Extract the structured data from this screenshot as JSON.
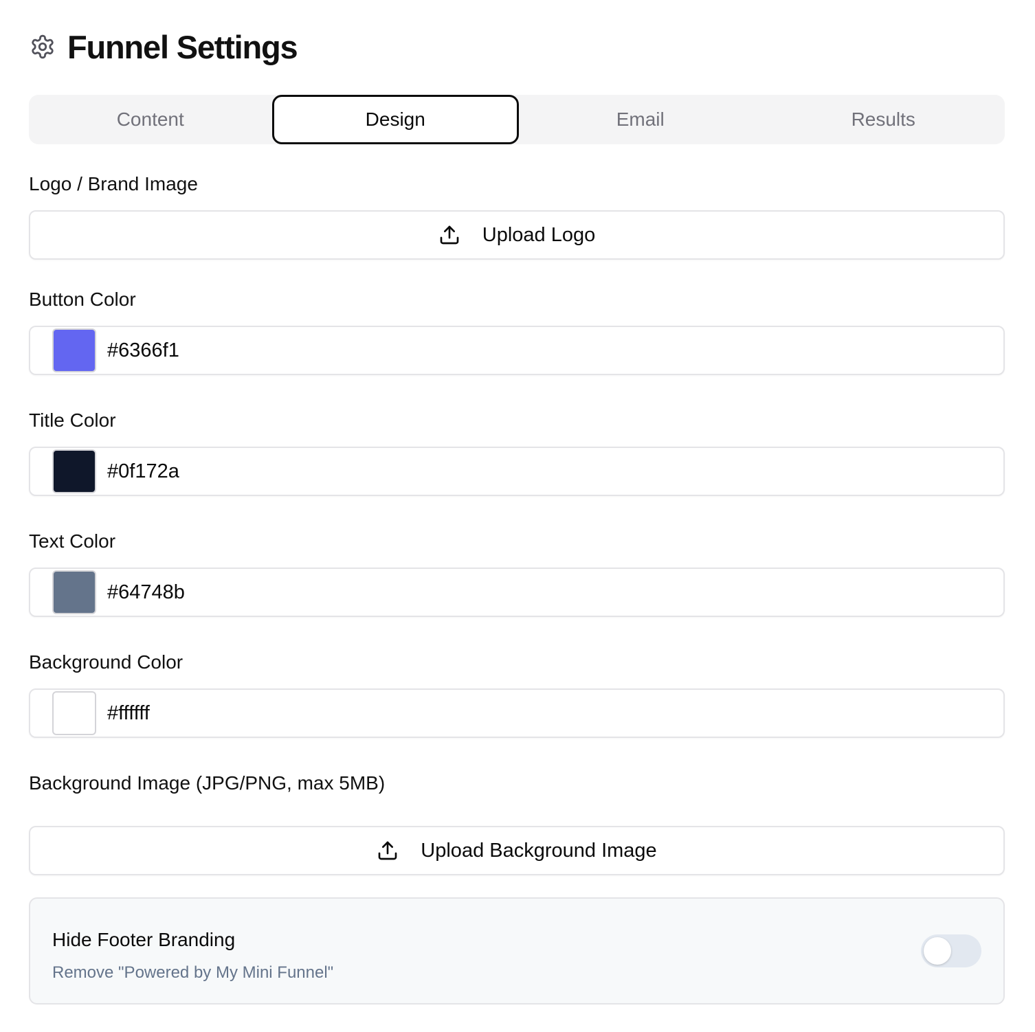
{
  "header": {
    "title": "Funnel Settings",
    "icon": "gear-icon"
  },
  "tabs": [
    {
      "label": "Content",
      "active": false
    },
    {
      "label": "Design",
      "active": true
    },
    {
      "label": "Email",
      "active": false
    },
    {
      "label": "Results",
      "active": false
    }
  ],
  "logo": {
    "label": "Logo / Brand Image",
    "button_label": "Upload Logo",
    "icon": "upload-icon"
  },
  "button_color": {
    "label": "Button Color",
    "value": "#6366f1"
  },
  "title_color": {
    "label": "Title Color",
    "value": "#0f172a"
  },
  "text_color": {
    "label": "Text Color",
    "value": "#64748b"
  },
  "background_color": {
    "label": "Background Color",
    "value": "#ffffff"
  },
  "background_image": {
    "label": "Background Image (JPG/PNG, max 5MB)",
    "button_label": "Upload Background Image",
    "icon": "upload-icon"
  },
  "footer_branding": {
    "title": "Hide Footer Branding",
    "description": "Remove \"Powered by My Mini Funnel\"",
    "enabled": false
  }
}
